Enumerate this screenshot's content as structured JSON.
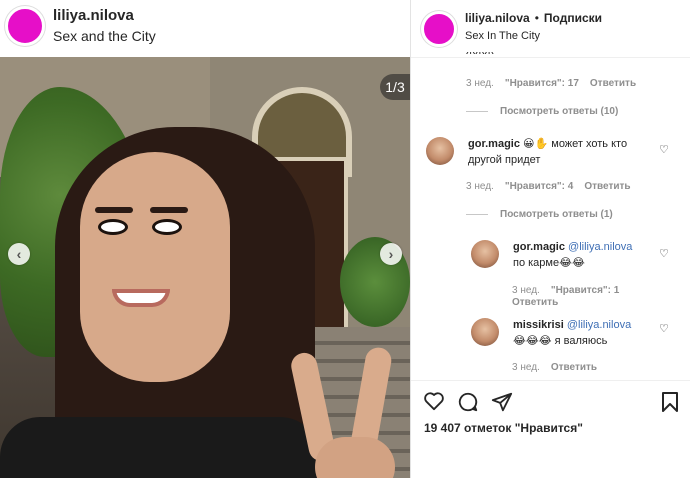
{
  "left": {
    "username": "liliya.nilova",
    "subtitle": "Sex and the City",
    "counter": "1/3",
    "arrow_left": "‹",
    "arrow_right": "›"
  },
  "right": {
    "username": "liliya.nilova",
    "dot": "•",
    "follow": "Подписки",
    "subtitle": "Sex In The City",
    "top_meta": {
      "time": "3 нед.",
      "likes": "\"Нравится\": 17",
      "reply": "Ответить"
    },
    "top_replies": "Посмотреть ответы (10)",
    "comments": [
      {
        "user": "gor.magic",
        "text": "😀✋ может хоть кто другой придет",
        "time": "3 нед.",
        "likes": "\"Нравится\": 4",
        "reply": "Ответить",
        "replies": "Посмотреть ответы (1)"
      },
      {
        "user": "gor.magic",
        "mention": "@liliya.nilova",
        "text": "по карме😂😂",
        "time": "3 нед.",
        "likes": "\"Нравится\": 1",
        "reply": "Ответить"
      },
      {
        "user": "missikrisi",
        "mention": "@liliya.nilova",
        "text": "😂😂😂 я валяюсь",
        "time": "3 нед.",
        "reply": "Ответить"
      }
    ],
    "likes_count": "19 407 отметок \"Нравится\"",
    "icons": {
      "like": "heart-outline-icon",
      "comment": "comment-icon",
      "share": "share-icon",
      "save": "bookmark-icon"
    }
  },
  "colors": {
    "avatar": "#e60fc8",
    "mention": "#3f6fb5",
    "meta": "#8e8e8e"
  }
}
